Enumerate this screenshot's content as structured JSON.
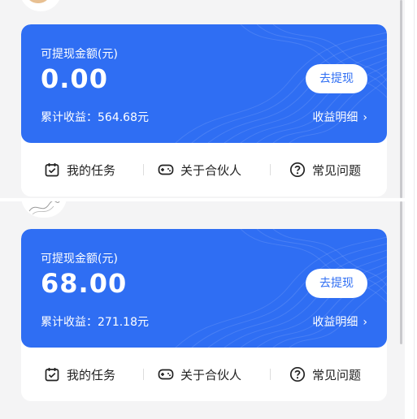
{
  "cards": [
    {
      "balance_label": "可提现金额(元)",
      "balance": "0.00",
      "withdraw_label": "去提现",
      "cumulative_text": "累计收益：564.68元",
      "detail_label": "收益明细",
      "actions": {
        "tasks": "我的任务",
        "partner": "关于合伙人",
        "faq": "常见问题"
      }
    },
    {
      "name_partial": "...",
      "balance_label": "可提现金额(元)",
      "balance": "68.00",
      "withdraw_label": "去提现",
      "cumulative_text": "累计收益：271.18元",
      "detail_label": "收益明细",
      "actions": {
        "tasks": "我的任务",
        "partner": "关于合伙人",
        "faq": "常见问题"
      }
    }
  ],
  "icons": {
    "chevron": "chevron-right-icon",
    "tasks": "calendar-check-icon",
    "partner": "gamepad-icon",
    "faq": "question-circle-icon"
  },
  "colors": {
    "primary": "#2f6ef3",
    "background": "#f4f4f5",
    "card": "#ffffff"
  }
}
